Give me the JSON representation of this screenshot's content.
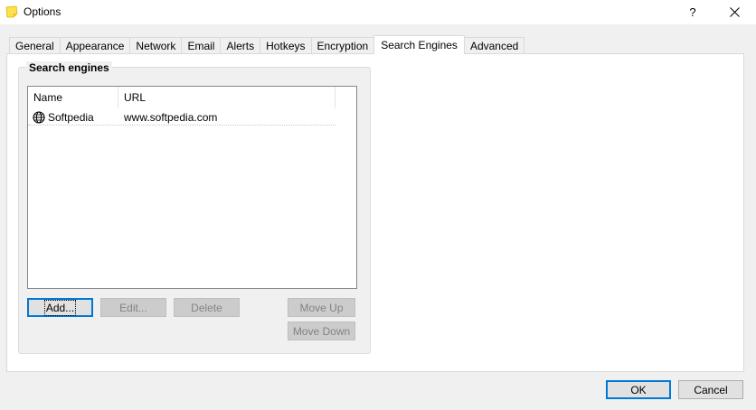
{
  "window": {
    "title": "Options",
    "help_label": "?",
    "icon": "sticky-note-icon",
    "accent_color": "#0078d7"
  },
  "tabs": [
    {
      "label": "General"
    },
    {
      "label": "Appearance"
    },
    {
      "label": "Network"
    },
    {
      "label": "Email"
    },
    {
      "label": "Alerts"
    },
    {
      "label": "Hotkeys"
    },
    {
      "label": "Encryption"
    },
    {
      "label": "Search Engines",
      "active": true
    },
    {
      "label": "Advanced"
    }
  ],
  "search_engines": {
    "group_title": "Search engines",
    "columns": {
      "name": "Name",
      "url": "URL"
    },
    "rows": [
      {
        "name": "Softpedia",
        "url": "www.softpedia.com",
        "icon": "globe-icon"
      }
    ],
    "buttons": {
      "add": "Add...",
      "edit": "Edit...",
      "delete": "Delete",
      "move_up": "Move Up",
      "move_down": "Move Down"
    }
  },
  "footer": {
    "ok": "OK",
    "cancel": "Cancel"
  }
}
